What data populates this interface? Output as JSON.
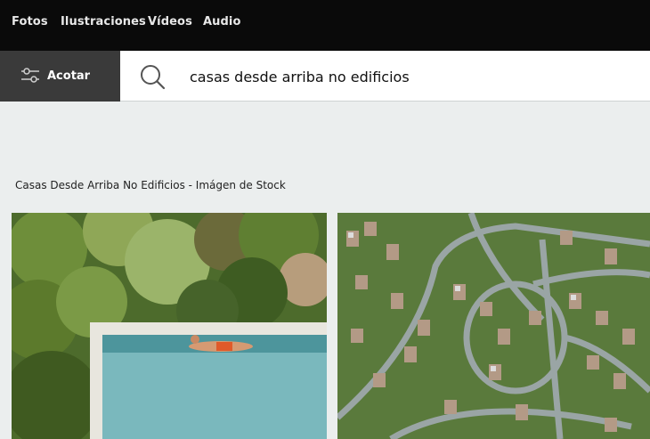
{
  "nav": {
    "items": [
      "Fotos",
      "Ilustraciones",
      "Vídeos",
      "Audio"
    ]
  },
  "search": {
    "refine_label": "Acotar",
    "query": "casas desde arriba no edificios"
  },
  "results": {
    "heading": "Casas Desde Arriba No Edificios - Imágen de Stock"
  },
  "colors": {
    "nav_bg": "#0a0a0a",
    "refine_bg": "#3a3a3a",
    "page_bg": "#ebeeee"
  },
  "icons": [
    "sliders-icon",
    "search-icon"
  ]
}
